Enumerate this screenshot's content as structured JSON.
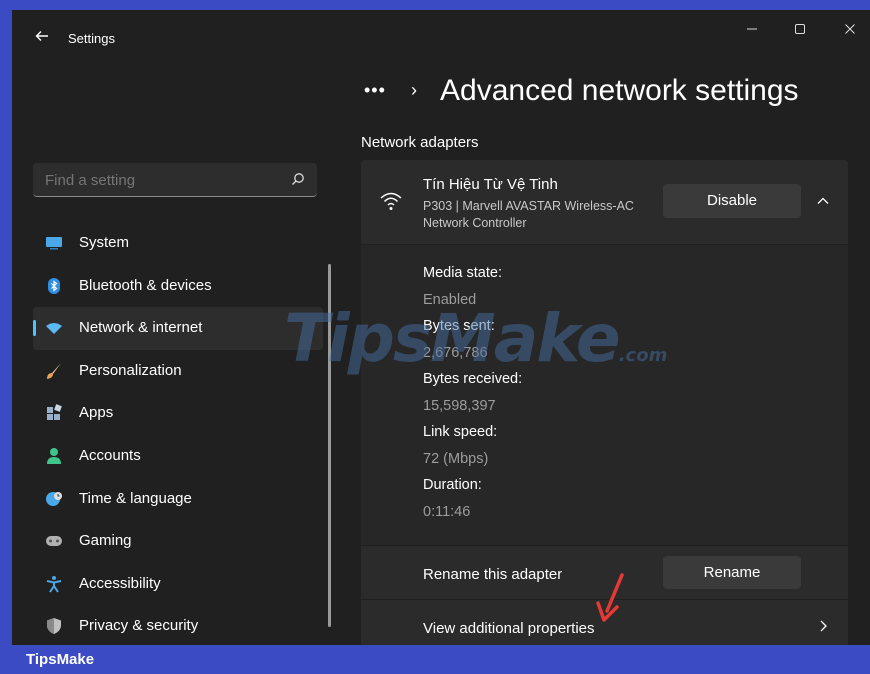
{
  "window": {
    "title": "Settings"
  },
  "search": {
    "placeholder": "Find a setting"
  },
  "sidebar": {
    "items": [
      {
        "label": "System",
        "icon": "monitor-icon",
        "color": "#4aa8e8"
      },
      {
        "label": "Bluetooth & devices",
        "icon": "bluetooth-icon",
        "color": "#2e8fe6"
      },
      {
        "label": "Network & internet",
        "icon": "wifi-network-icon",
        "color": "#5bb8f0",
        "active": true
      },
      {
        "label": "Personalization",
        "icon": "brush-icon",
        "color": "#e8a25a"
      },
      {
        "label": "Apps",
        "icon": "apps-icon",
        "color": "#9ab0c8"
      },
      {
        "label": "Accounts",
        "icon": "person-icon",
        "color": "#3fc48a"
      },
      {
        "label": "Time & language",
        "icon": "globe-clock-icon",
        "color": "#4aa8e8"
      },
      {
        "label": "Gaming",
        "icon": "gamepad-icon",
        "color": "#b0b0b0"
      },
      {
        "label": "Accessibility",
        "icon": "accessibility-icon",
        "color": "#4aa8e8"
      },
      {
        "label": "Privacy & security",
        "icon": "shield-icon",
        "color": "#c0c0c0"
      }
    ]
  },
  "header": {
    "more": "•••",
    "separator": "›",
    "title": "Advanced network settings"
  },
  "section": {
    "title": "Network adapters"
  },
  "adapter": {
    "name": "Tín Hiệu Từ Vệ Tinh",
    "description": "P303 | Marvell AVASTAR Wireless-AC Network Controller",
    "disable_label": "Disable",
    "properties": [
      {
        "label": "Media state:",
        "value": "Enabled"
      },
      {
        "label": "Bytes sent:",
        "value": "2,676,786"
      },
      {
        "label": "Bytes received:",
        "value": "15,598,397"
      },
      {
        "label": "Link speed:",
        "value": "72 (Mbps)"
      },
      {
        "label": "Duration:",
        "value": "0:11:46"
      }
    ]
  },
  "rename": {
    "label": "Rename this adapter",
    "button": "Rename"
  },
  "view_props": {
    "label": "View additional properties"
  },
  "watermark": {
    "text": "TipsMake",
    "suffix": ".com"
  },
  "footer": {
    "brand": "TipsMake"
  },
  "colors": {
    "accent": "#4cc2ff",
    "frame": "#3b4bc4",
    "arrow": "#e53935"
  }
}
